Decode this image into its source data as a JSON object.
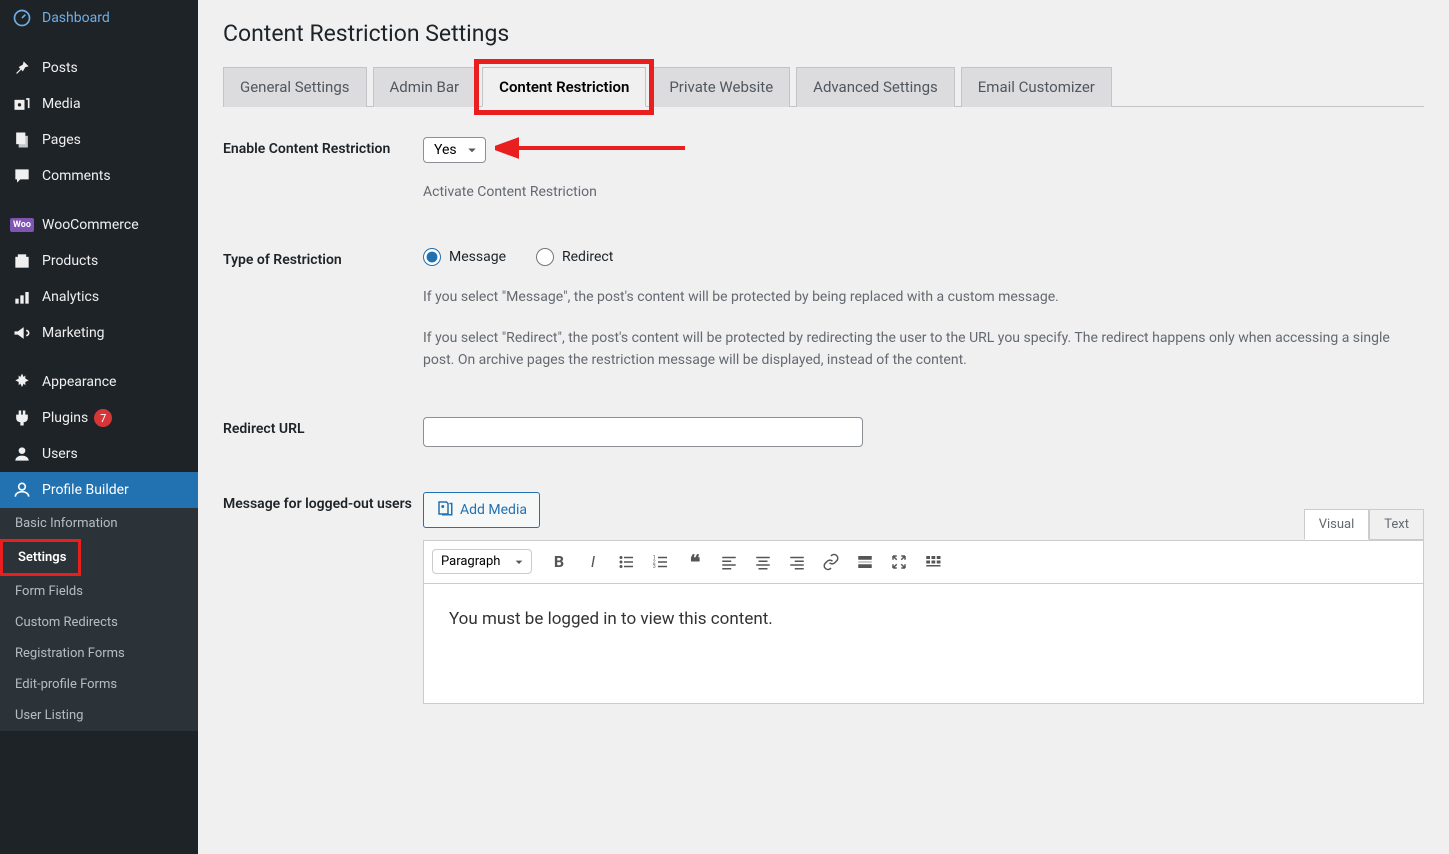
{
  "sidebar": {
    "items": [
      {
        "label": "Dashboard",
        "icon": "dashboard"
      },
      {
        "label": "Posts",
        "icon": "pin"
      },
      {
        "label": "Media",
        "icon": "media"
      },
      {
        "label": "Pages",
        "icon": "pages"
      },
      {
        "label": "Comments",
        "icon": "comments"
      },
      {
        "label": "WooCommerce",
        "icon": "woo"
      },
      {
        "label": "Products",
        "icon": "products"
      },
      {
        "label": "Analytics",
        "icon": "analytics"
      },
      {
        "label": "Marketing",
        "icon": "marketing"
      },
      {
        "label": "Appearance",
        "icon": "appearance"
      },
      {
        "label": "Plugins",
        "icon": "plugins",
        "badge": "7"
      },
      {
        "label": "Users",
        "icon": "users"
      },
      {
        "label": "Profile Builder",
        "icon": "profile",
        "active": true
      }
    ],
    "submenu": [
      "Basic Information",
      "Settings",
      "Form Fields",
      "Custom Redirects",
      "Registration Forms",
      "Edit-profile Forms",
      "User Listing"
    ]
  },
  "page": {
    "title": "Content Restriction Settings"
  },
  "tabs": [
    "General Settings",
    "Admin Bar",
    "Content Restriction",
    "Private Website",
    "Advanced Settings",
    "Email Customizer"
  ],
  "form": {
    "enable_label": "Enable Content Restriction",
    "enable_value": "Yes",
    "enable_helper": "Activate Content Restriction",
    "type_label": "Type of Restriction",
    "type_options": {
      "message": "Message",
      "redirect": "Redirect"
    },
    "type_helper1": "If you select \"Message\", the post's content will be protected by being replaced with a custom message.",
    "type_helper2": "If you select \"Redirect\", the post's content will be protected by redirecting the user to the URL you specify. The redirect happens only when accessing a single post. On archive pages the restriction message will be displayed, instead of the content.",
    "redirect_label": "Redirect URL",
    "redirect_value": "",
    "message_label": "Message for logged-out users",
    "add_media": "Add Media",
    "editor_tabs": {
      "visual": "Visual",
      "text": "Text"
    },
    "paragraph_select": "Paragraph",
    "editor_content": "You must be logged in to view this content."
  }
}
